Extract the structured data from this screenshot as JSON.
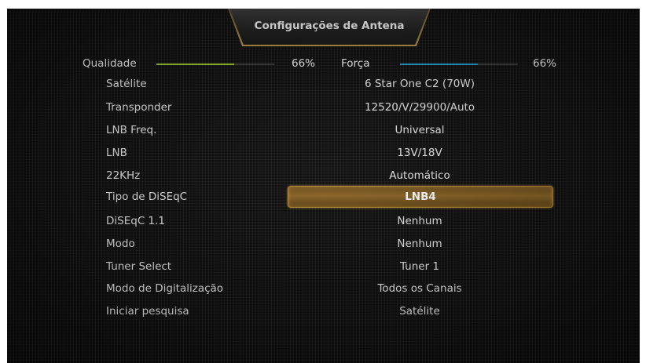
{
  "dialog": {
    "title": "Configurações de Antena"
  },
  "meters": {
    "quality": {
      "label": "Qualidade",
      "percent_text": "66%",
      "level": 0.66,
      "color": "#9ac12a"
    },
    "strength": {
      "label": "Força",
      "percent_text": "66%",
      "level": 0.66,
      "color": "#1f9ad6"
    }
  },
  "settings": [
    {
      "label": "Satélite",
      "value": "6 Star One C2  (70W)"
    },
    {
      "label": "Transponder",
      "value": "12520/V/29900/Auto"
    },
    {
      "label": "LNB Freq.",
      "value": "Universal"
    },
    {
      "label": "LNB",
      "value": "13V/18V"
    },
    {
      "label": "22KHz",
      "value": "Automático"
    },
    {
      "label": "Tipo de DiSEqC",
      "value": "LNB4",
      "selected": true
    },
    {
      "label": "DiSEqC 1.1",
      "value": "Nenhum"
    },
    {
      "label": "Modo",
      "value": "Nenhum"
    },
    {
      "label": "Tuner Select",
      "value": "Tuner 1"
    },
    {
      "label": "Modo de Digitalização",
      "value": "Todos os Canais"
    },
    {
      "label": "Iniciar pesquisa",
      "value": "Satélite"
    }
  ]
}
